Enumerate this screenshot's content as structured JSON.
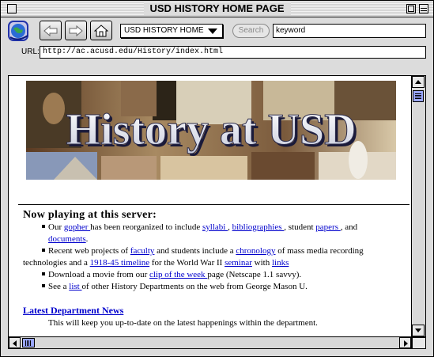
{
  "window": {
    "title": "USD HISTORY HOME PAGE"
  },
  "toolbar": {
    "site_select": "USD HISTORY HOME",
    "search_label": "Search",
    "keyword_value": "keyword"
  },
  "address": {
    "label": "URL:",
    "value": "http://ac.acusd.edu/History/index.html"
  },
  "banner": {
    "text": "History at USD"
  },
  "content": {
    "heading": "Now playing at this server:",
    "bullet1": {
      "pre": "Our ",
      "gopher": "gopher ",
      "mid1": "has been reorganized to include ",
      "syllabi": "syllabi ",
      "sep1": ", ",
      "bibliographies": "bibliographies ",
      "sep2": ", student ",
      "papers": "papers ",
      "sep3": ", and",
      "documents": "documents",
      "end": "."
    },
    "bullet2": {
      "pre": "Recent web projects of ",
      "faculty": "faculty",
      "mid1": " and students include a ",
      "chronology": "chronology",
      "mid2": " of mass media recording",
      "pre2": "technologies and a ",
      "timeline": "1918-45 timeline",
      "mid3": " for the World War II ",
      "seminar": "seminar",
      "mid4": " with ",
      "links": "links"
    },
    "bullet3": {
      "pre": "Download a movie from our ",
      "clip": "clip of the week ",
      "end": "page (Netscape 1.1 savvy)."
    },
    "bullet4": {
      "pre": "See a ",
      "list": "list ",
      "end": "of other History Departments on the web from George Mason U."
    },
    "news_link": "Latest Department News",
    "news_desc": "This will keep you up-to-date on the latest happenings within the department."
  },
  "colors": {
    "link": "#0000cc",
    "scroll_thumb": "#9aa6ff",
    "chrome": "#dcdcdc"
  },
  "icons": [
    "globe-logo-icon",
    "back-arrow-icon",
    "forward-arrow-icon",
    "home-icon"
  ]
}
